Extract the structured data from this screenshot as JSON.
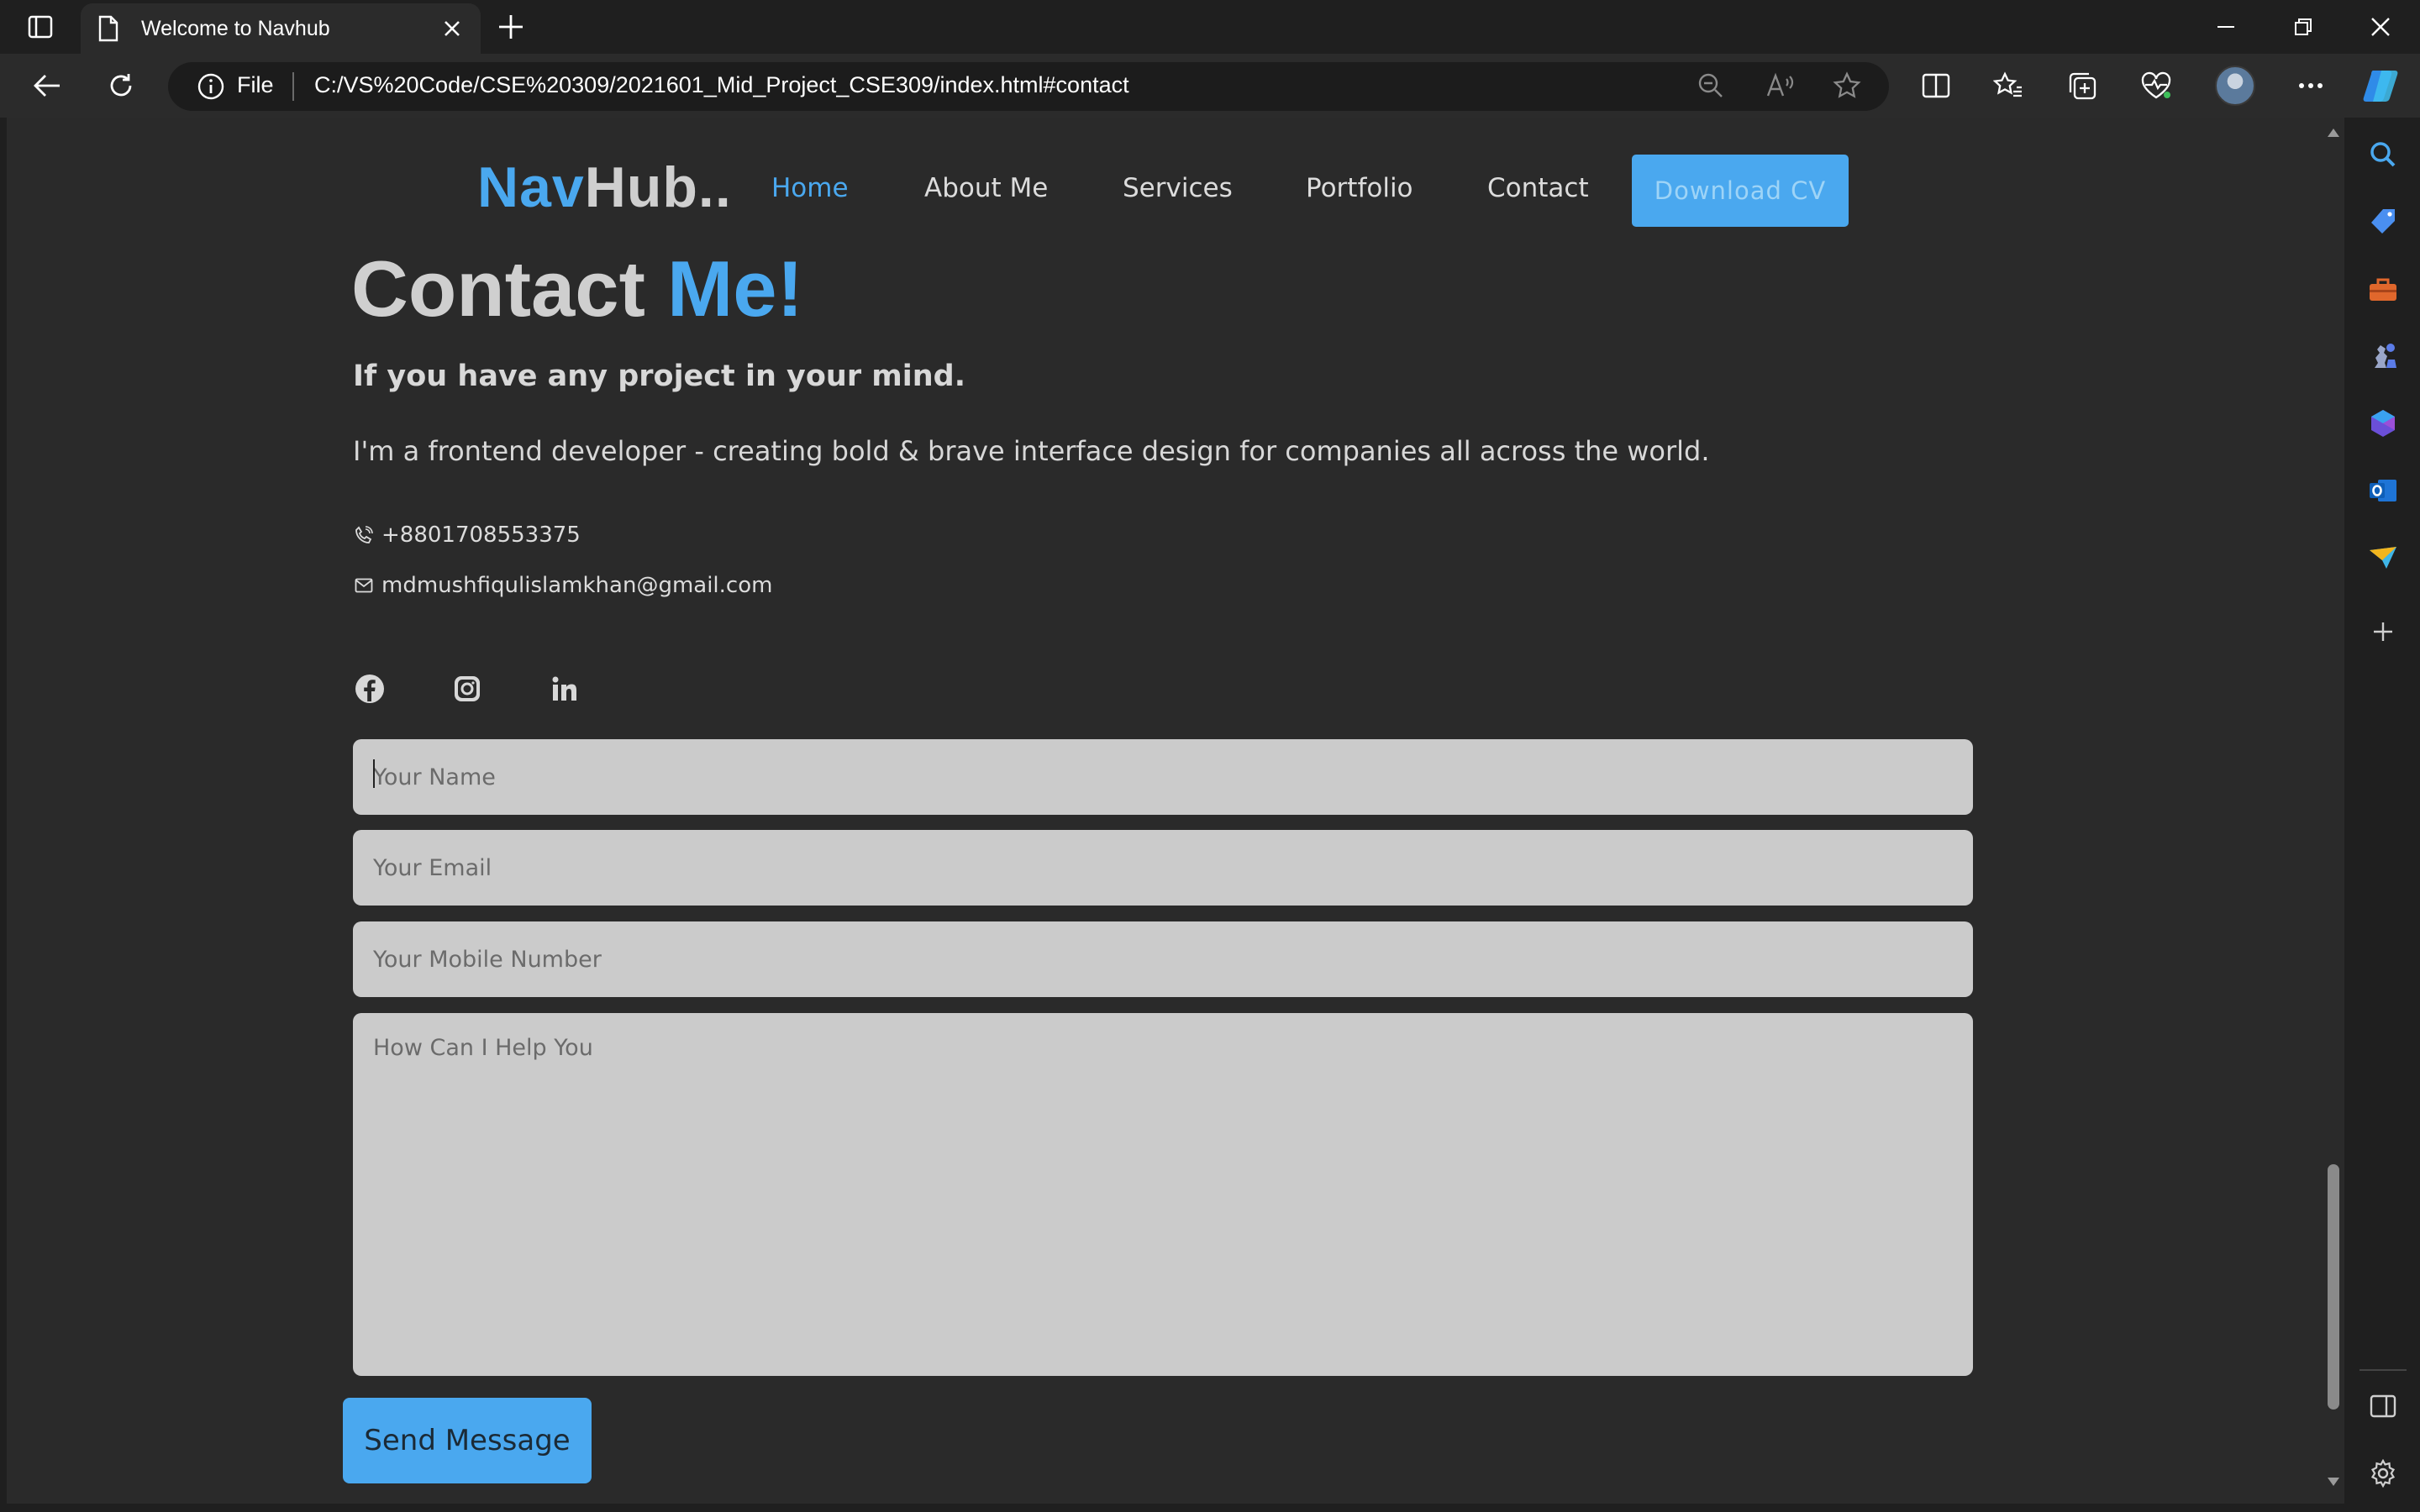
{
  "browser": {
    "tab_title": "Welcome to Navhub",
    "address_scheme_label": "File",
    "url": "C:/VS%20Code/CSE%20309/2021601_Mid_Project_CSE309/index.html#contact"
  },
  "site": {
    "logo_part1": "Nav",
    "logo_part2": "Hub..",
    "nav": {
      "home": "Home",
      "about": "About Me",
      "services": "Services",
      "portfolio": "Portfolio",
      "contact": "Contact"
    },
    "download_cv": "Download CV",
    "contact_title_part1": "Contact ",
    "contact_title_part2": "Me!",
    "subtitle": "If you have any project in your mind.",
    "tagline": "I'm a frontend developer - creating bold & brave interface design for companies all across the world.",
    "phone": "+8801708553375",
    "email": "mdmushfiqulislamkhan@gmail.com",
    "form": {
      "name_placeholder": "Your Name",
      "email_placeholder": "Your Email",
      "mobile_placeholder": "Your Mobile Number",
      "message_placeholder": "How Can I Help You",
      "submit_label": "Send Message"
    }
  },
  "colors": {
    "accent": "#4aa8ef",
    "page_bg": "#2a2a2a",
    "field_bg": "#cbcbcb"
  },
  "icons": {
    "social": [
      "facebook-icon",
      "instagram-icon",
      "linkedin-icon"
    ],
    "contact": [
      "phone-icon",
      "mail-icon"
    ]
  }
}
